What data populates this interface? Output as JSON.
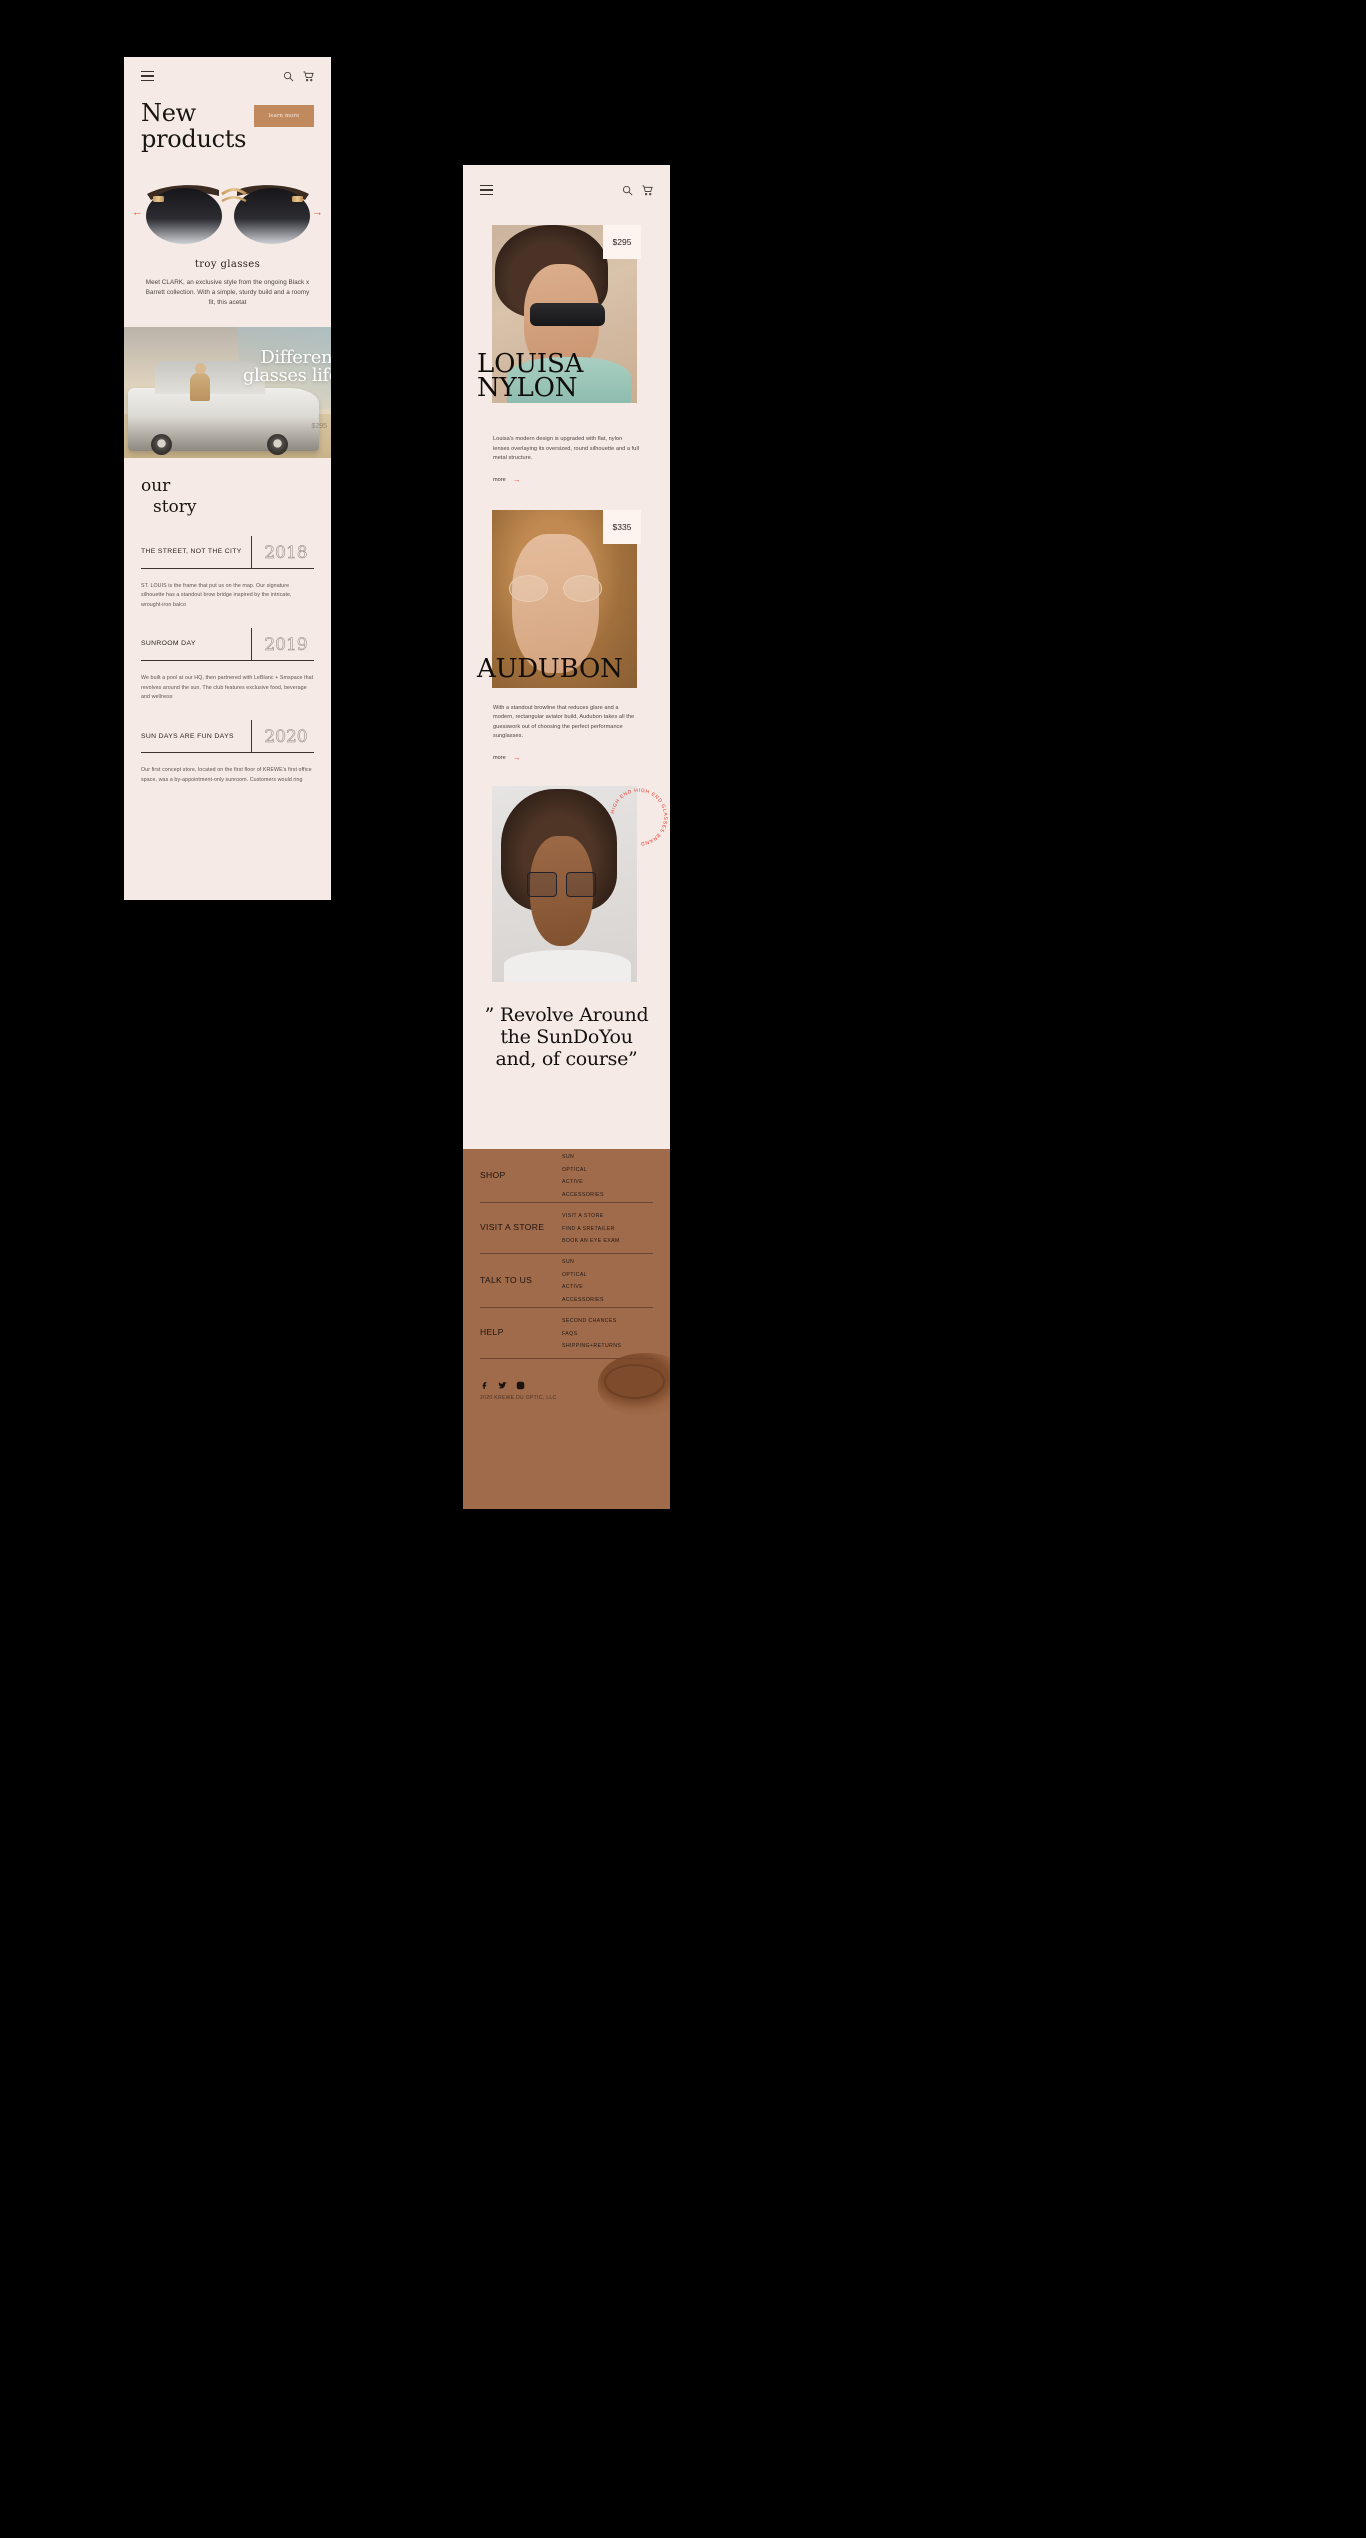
{
  "panel1": {
    "header": {
      "menu_icon": "hamburger-icon",
      "search_icon": "search-icon",
      "cart_icon": "cart-icon"
    },
    "hero": {
      "title_line1": "New",
      "title_line2": "products",
      "cta_label": "learn more"
    },
    "carousel": {
      "prev_label": "←",
      "next_label": "→",
      "product_name": "troy glasses",
      "product_desc": "Meet CLARK, an exclusive style from the ongoing Black x Barrett collection. With a simple, sturdy build and a roomy fit, this acetat"
    },
    "banner": {
      "line1": "Different",
      "line2": "glasses",
      "line3": "life",
      "price_watermark": "$295"
    },
    "story": {
      "title_line1": "our",
      "title_line2": "story",
      "items": [
        {
          "label": "THE STREET, NOT THE CITY",
          "year": "2018",
          "body": "ST. LOUIS is the frame that put us on the map. Our signature silhouette has a standout brow bridge inspired by the intricate, wrought-iron balco"
        },
        {
          "label": "SUNROOM DAY",
          "year": "2019",
          "body": "We built a pool at our HQ, then partnered with LeBlanc + Smspace that revolves around the sun. The club features exclusive food, beverage and wellness"
        },
        {
          "label": "SUN DAYS ARE FUN DAYS",
          "year": "2020",
          "body": "Our first concept store, located on the first floor of KREWE's first office space, was a by-appointment-only sunroom. Customers would ring"
        }
      ]
    }
  },
  "panel2": {
    "header": {
      "menu_icon": "hamburger-icon",
      "search_icon": "search-icon",
      "cart_icon": "cart-icon"
    },
    "cards": [
      {
        "price": "$295",
        "title_line1": "LOUISA",
        "title_line2": "NYLON",
        "desc": "Louisa's modern design is upgraded with flat, nylon lenses overlaying its oversized, round silhouette and a full metal structure.",
        "more_label": "more"
      },
      {
        "price": "$335",
        "title_line1": "AUDUBON",
        "title_line2": "",
        "desc": "With a standout browline that reduces glare and a modern, rectangular aviator build, Audubon takes all the guesswork out of choosing the perfect performance sunglasses.",
        "more_label": "more"
      }
    ],
    "badge_text": "HIGH END  HIGH END GLASSES BRAND ",
    "quote": {
      "line1": "” Revolve Around",
      "line2": "the SunDoYou",
      "line3": "and, of course”"
    }
  },
  "footer": {
    "columns": [
      {
        "heading": "SHOP",
        "links": [
          "SUN",
          "OPTICAL",
          "ACTIVE",
          "ACCESSORIES"
        ]
      },
      {
        "heading": "VISIT A STORE",
        "links": [
          "VISIT A STORE",
          "FIND A SRETAILER",
          "BOOK AN EYE EXAM"
        ]
      },
      {
        "heading": "TALK TO US",
        "links": [
          "SUN",
          "OPTICAL",
          "ACTIVE",
          "ACCESSORIES"
        ]
      },
      {
        "heading": "HELP",
        "links": [
          "SECOND CHANCES",
          "FAQS",
          "SHIPPING+RETURNS"
        ]
      }
    ],
    "socials": [
      "facebook-icon",
      "twitter-icon",
      "instagram-icon"
    ],
    "copyright": "2020 KREWE DU OPTIC, LLC",
    "bg_color": "#a06b4a"
  },
  "colors": {
    "panel_bg": "#f5eae6",
    "accent_brown": "#c08a5e",
    "accent_red": "#e8543f",
    "badge_red": "#ef3b2c",
    "footer_bg": "#a06b4a"
  }
}
